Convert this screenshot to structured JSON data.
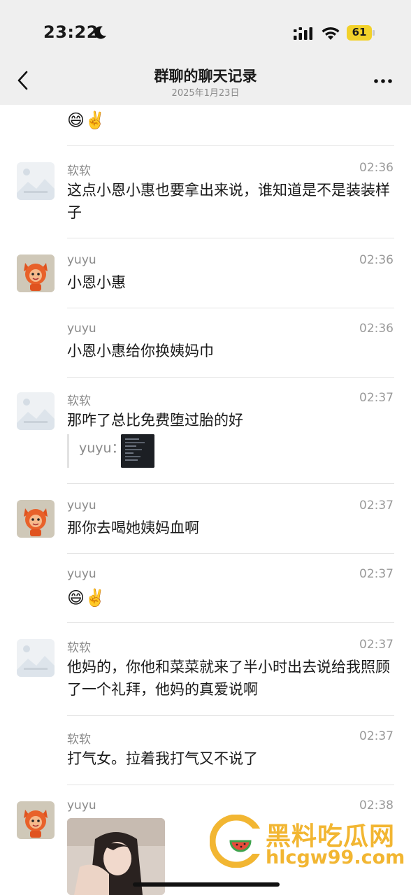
{
  "status_bar": {
    "time": "23:22",
    "battery": "61",
    "icons": [
      "moon-icon",
      "signal-icon",
      "wifi-icon",
      "battery-icon"
    ]
  },
  "header": {
    "title": "群聊的聊天记录",
    "subtitle": "2025年1月23日",
    "icons": [
      "back-chevron-icon",
      "more-dots-icon"
    ]
  },
  "messages": [
    {
      "sender": "",
      "time": "",
      "emoji": "😄✌️"
    },
    {
      "sender": "软软",
      "time": "02:36",
      "text": "这点小恩小惠也要拿出来说，谁知道是不是装装样子"
    },
    {
      "sender": "yuyu",
      "time": "02:36",
      "text": "小恩小惠"
    },
    {
      "sender": "yuyu",
      "time": "02:36",
      "text": "小恩小惠给你换姨妈巾"
    },
    {
      "sender": "软软",
      "time": "02:37",
      "text": "那咋了总比免费堕过胎的好",
      "quote_name": "yuyu："
    },
    {
      "sender": "yuyu",
      "time": "02:37",
      "text": "那你去喝她姨妈血啊"
    },
    {
      "sender": "yuyu",
      "time": "02:37",
      "emoji": "😄✌️"
    },
    {
      "sender": "软软",
      "time": "02:37",
      "text": "他妈的，你他和菜菜就来了半小时出去说给我照顾了一个礼拜，他妈的真爱说啊"
    },
    {
      "sender": "软软",
      "time": "02:37",
      "text": "打气女。拉着我打气又不说了"
    },
    {
      "sender": "yuyu",
      "time": "02:38"
    }
  ],
  "watermark": {
    "name": "黑料吃瓜网",
    "url": "hlcgw99.com"
  },
  "colors": {
    "bar_bg": "#efefef",
    "battery": "#f2d12a",
    "watermark": "#f2b632",
    "secondary_text": "#8a8a8a"
  }
}
